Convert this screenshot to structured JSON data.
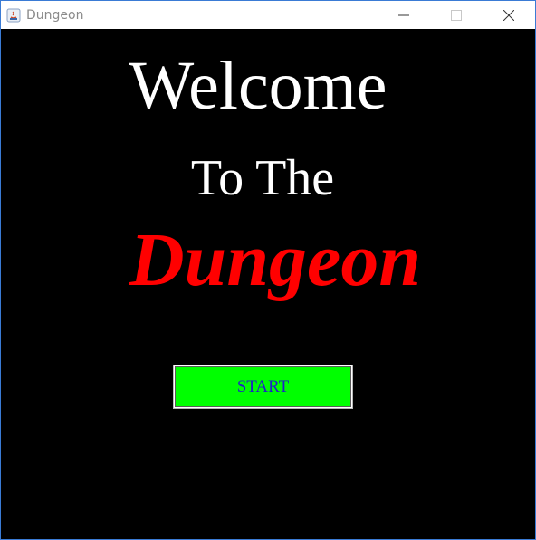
{
  "window": {
    "title": "Dungeon",
    "icon": "java-app-icon",
    "controls": [
      "minimize-icon",
      "maximize-icon",
      "close-icon"
    ]
  },
  "main": {
    "line1": "Welcome",
    "line2": "To The",
    "line3": "Dungeon",
    "start_label": "START"
  },
  "colors": {
    "background": "#000000",
    "heading": "#ffffff",
    "dungeon": "#ff0000",
    "button_bg": "#00ff00",
    "button_text": "#2020c8"
  }
}
